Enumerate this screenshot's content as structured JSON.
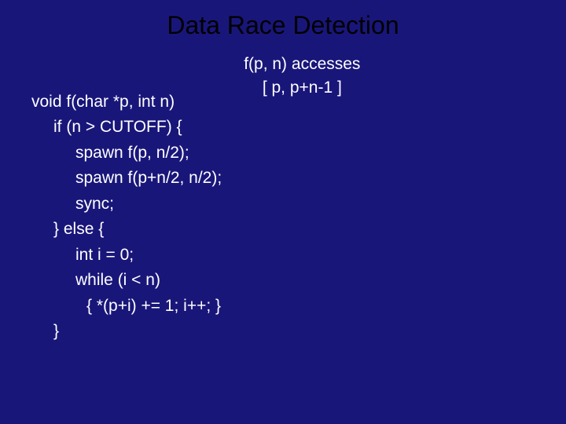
{
  "title": "Data Race Detection",
  "code": {
    "l1": "void f(char *p, int n)",
    "l2": "if (n > CUTOFF) {",
    "l3": "spawn f(p, n/2);",
    "l4": "spawn f(p+n/2, n/2);",
    "l5": "sync;",
    "l6": "} else {",
    "l7": "int i = 0;",
    "l8": "while (i < n)",
    "l9": "{ *(p+i) += 1; i++; }",
    "l10": "}"
  },
  "annotation": {
    "line1": "f(p, n) accesses",
    "line2": "[ p, p+n-1 ]"
  }
}
